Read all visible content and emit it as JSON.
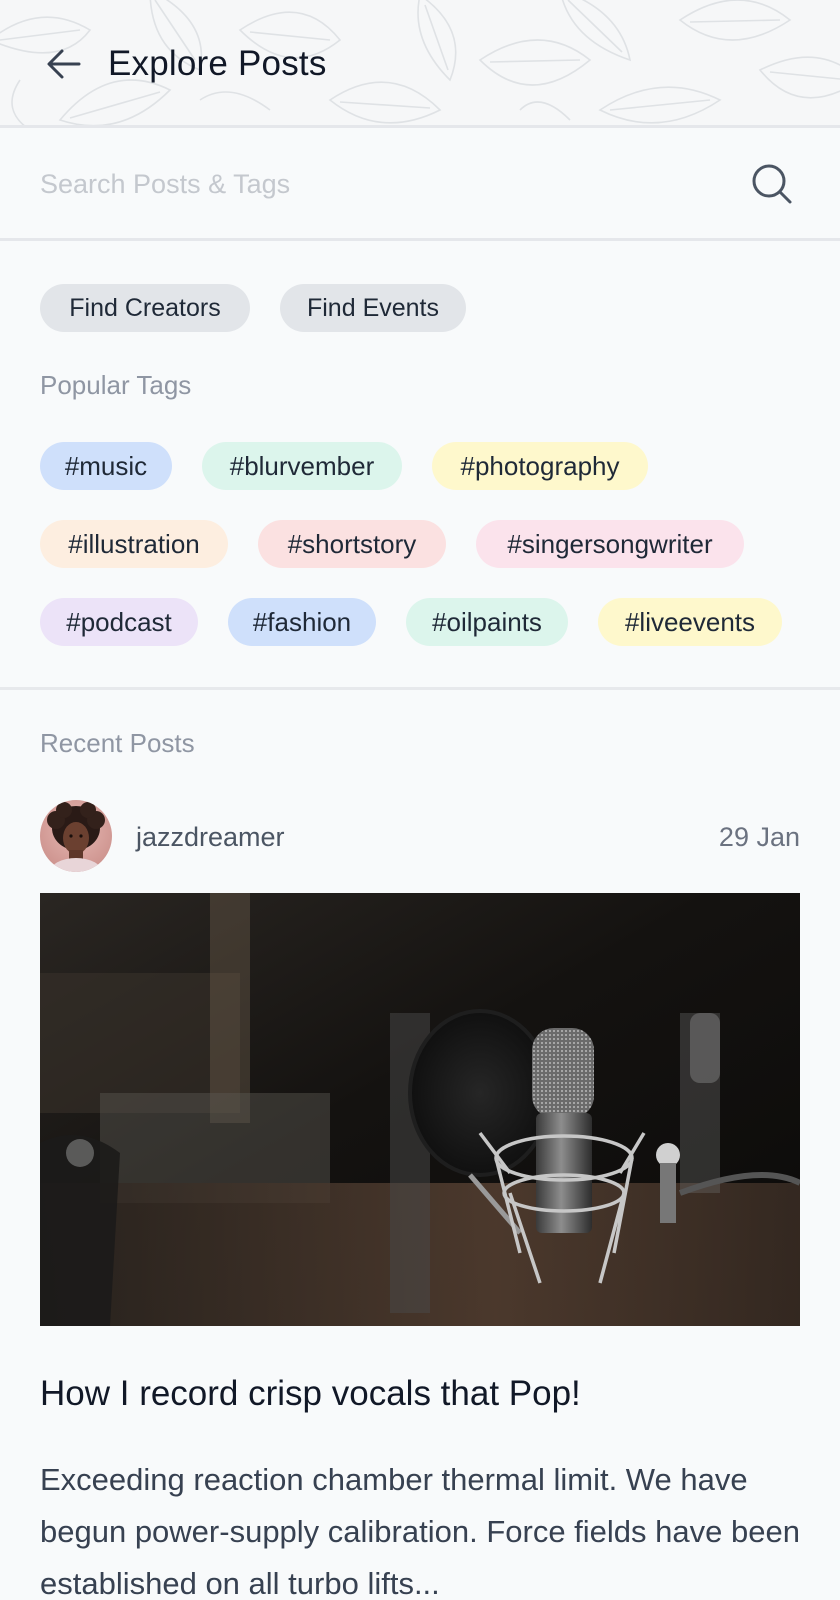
{
  "header": {
    "title": "Explore Posts",
    "back_icon": "arrow-left-icon"
  },
  "search": {
    "placeholder": "Search Posts & Tags",
    "value": "",
    "icon": "search-icon"
  },
  "quick_actions": [
    {
      "label": "Find Creators"
    },
    {
      "label": "Find Events"
    }
  ],
  "popular_tags": {
    "label": "Popular Tags",
    "tags": [
      {
        "label": "#music",
        "color": "#cfe0fb"
      },
      {
        "label": "#blurvember",
        "color": "#dcf5ec"
      },
      {
        "label": "#photography",
        "color": "#fef8cc"
      },
      {
        "label": "#illustration",
        "color": "#fdeee0"
      },
      {
        "label": "#shortstory",
        "color": "#fbe1e1"
      },
      {
        "label": "#singersongwriter",
        "color": "#fbe3ec"
      },
      {
        "label": "#podcast",
        "color": "#ece3f8"
      },
      {
        "label": "#fashion",
        "color": "#cfe0fb"
      },
      {
        "label": "#oilpaints",
        "color": "#dcf5ec"
      },
      {
        "label": "#liveevents",
        "color": "#fef8cc"
      }
    ]
  },
  "recent_posts": {
    "label": "Recent Posts",
    "posts": [
      {
        "author": "jazzdreamer",
        "date": "29 Jan",
        "title": "How I record crisp vocals that Pop!",
        "excerpt": "Exceeding reaction chamber thermal limit. We have begun power-supply calibration. Force fields have been established on all turbo lifts..."
      }
    ]
  },
  "colors": {
    "background": "#f8fafb",
    "text_primary": "#111827",
    "text_muted": "#8f96a3",
    "chip_gray": "#e2e5e9"
  }
}
